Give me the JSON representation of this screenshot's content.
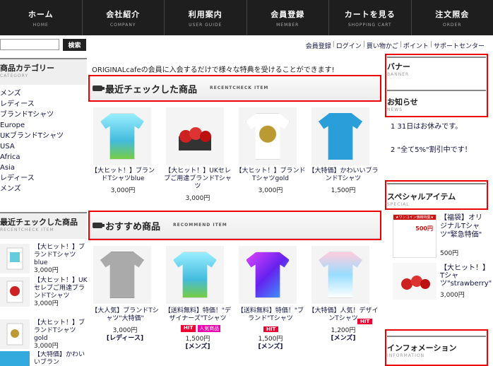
{
  "nav": [
    {
      "main": "ホーム",
      "sub": "HOME"
    },
    {
      "main": "会社紹介",
      "sub": "COMPANY"
    },
    {
      "main": "利用案内",
      "sub": "USER GUIDE"
    },
    {
      "main": "会員登録",
      "sub": "MEMBER"
    },
    {
      "main": "カートを見る",
      "sub": "SHOPPING CART"
    },
    {
      "main": "注文照会",
      "sub": "ORDER"
    }
  ],
  "search": {
    "button": "検索",
    "value": ""
  },
  "util": [
    "会員登録",
    "ログイン",
    "買い物かご",
    "ポイント",
    "サポートセンター"
  ],
  "category": {
    "title": "商品カテゴリー",
    "sub": "CATEGORY",
    "items": [
      "メンズ",
      "レディース",
      "ブランドTシャツ",
      "Europe",
      "UKブランドTシャツ",
      "USA",
      "Africa",
      "Asia",
      "レディース",
      "メンズ"
    ]
  },
  "intro": "ORIGINALcafeの会員に入会するだけで様々な特典を受けることができます!",
  "recent": {
    "title": "最近チェックした商品",
    "en": "RECENTCHECK ITEM",
    "items": [
      {
        "name": "【大ヒット！】ブランドTシャツblue",
        "price": "3,000円"
      },
      {
        "name": "【大ヒット！】UKセレブご用達ブランドTシャツ",
        "price": "3,000円"
      },
      {
        "name": "【大ヒット！】ブランドTシャツgold",
        "price": "3,000円"
      },
      {
        "name": "【大特価】かわいいブランドTシャツ",
        "price": "1,500円"
      }
    ]
  },
  "recommend": {
    "title": "おすすめ商品",
    "en": "RECOMMEND ITEM",
    "items": [
      {
        "name": "【大人気】ブランドTシャツ\"大特価\"",
        "price": "3,000円",
        "cat": "[レディース]"
      },
      {
        "name": "【送料無料】特価！\"デザイナーズ\"Tシャツ",
        "price": "1,500円",
        "cat": "[メンズ]",
        "hit": "HIT",
        "pop": "人気商品"
      },
      {
        "name": "【送料無料】特価！\"ブランド\"Tシャツ",
        "price": "1,500円",
        "cat": "[メンズ]",
        "hit": "HIT"
      },
      {
        "name": "【大特価】人気！デザインTシャツ",
        "price": "1,200円",
        "cat": "[メンズ]",
        "hit": "HIT"
      }
    ]
  },
  "leftRecent": {
    "title": "最近チェックした商品",
    "sub": "RECENTCHECK ITEM",
    "items": [
      {
        "name": "【大ヒット！】ブランドTシャツblue",
        "price": "3,000円"
      },
      {
        "name": "【大ヒット！】UKセレブご用達ブランドTシャツ",
        "price": "3,000円"
      },
      {
        "name": "【大ヒット！】ブランドTシャツgold",
        "price": "3,000円"
      },
      {
        "name": "【大特価】かわいいブラン"
      }
    ]
  },
  "banner": {
    "title": "バナー",
    "sub": "BANNER"
  },
  "news": {
    "title": "お知らせ",
    "sub": "NEWS",
    "items": [
      "1 31日はお休みです。",
      "2 \"全て5%\"割引中です！"
    ]
  },
  "special": {
    "title": "スペシャルアイテム",
    "sub": "SPECIAL",
    "items": [
      {
        "name": "【福袋】オリジナルTシャツ\"緊急特価\"",
        "price": "500円",
        "badge": "★ワンコイン価格特集★",
        "badge2": "500円"
      },
      {
        "name": "【大ヒット！】Tシャツ\"strawberry\"",
        "price": "3,000円"
      }
    ]
  },
  "info": {
    "title": "インフォメーション",
    "sub": "INFORMATION"
  },
  "colors": {
    "nav": "#1e1e1e",
    "red": "#ee0000",
    "hit": "#ee0033"
  }
}
